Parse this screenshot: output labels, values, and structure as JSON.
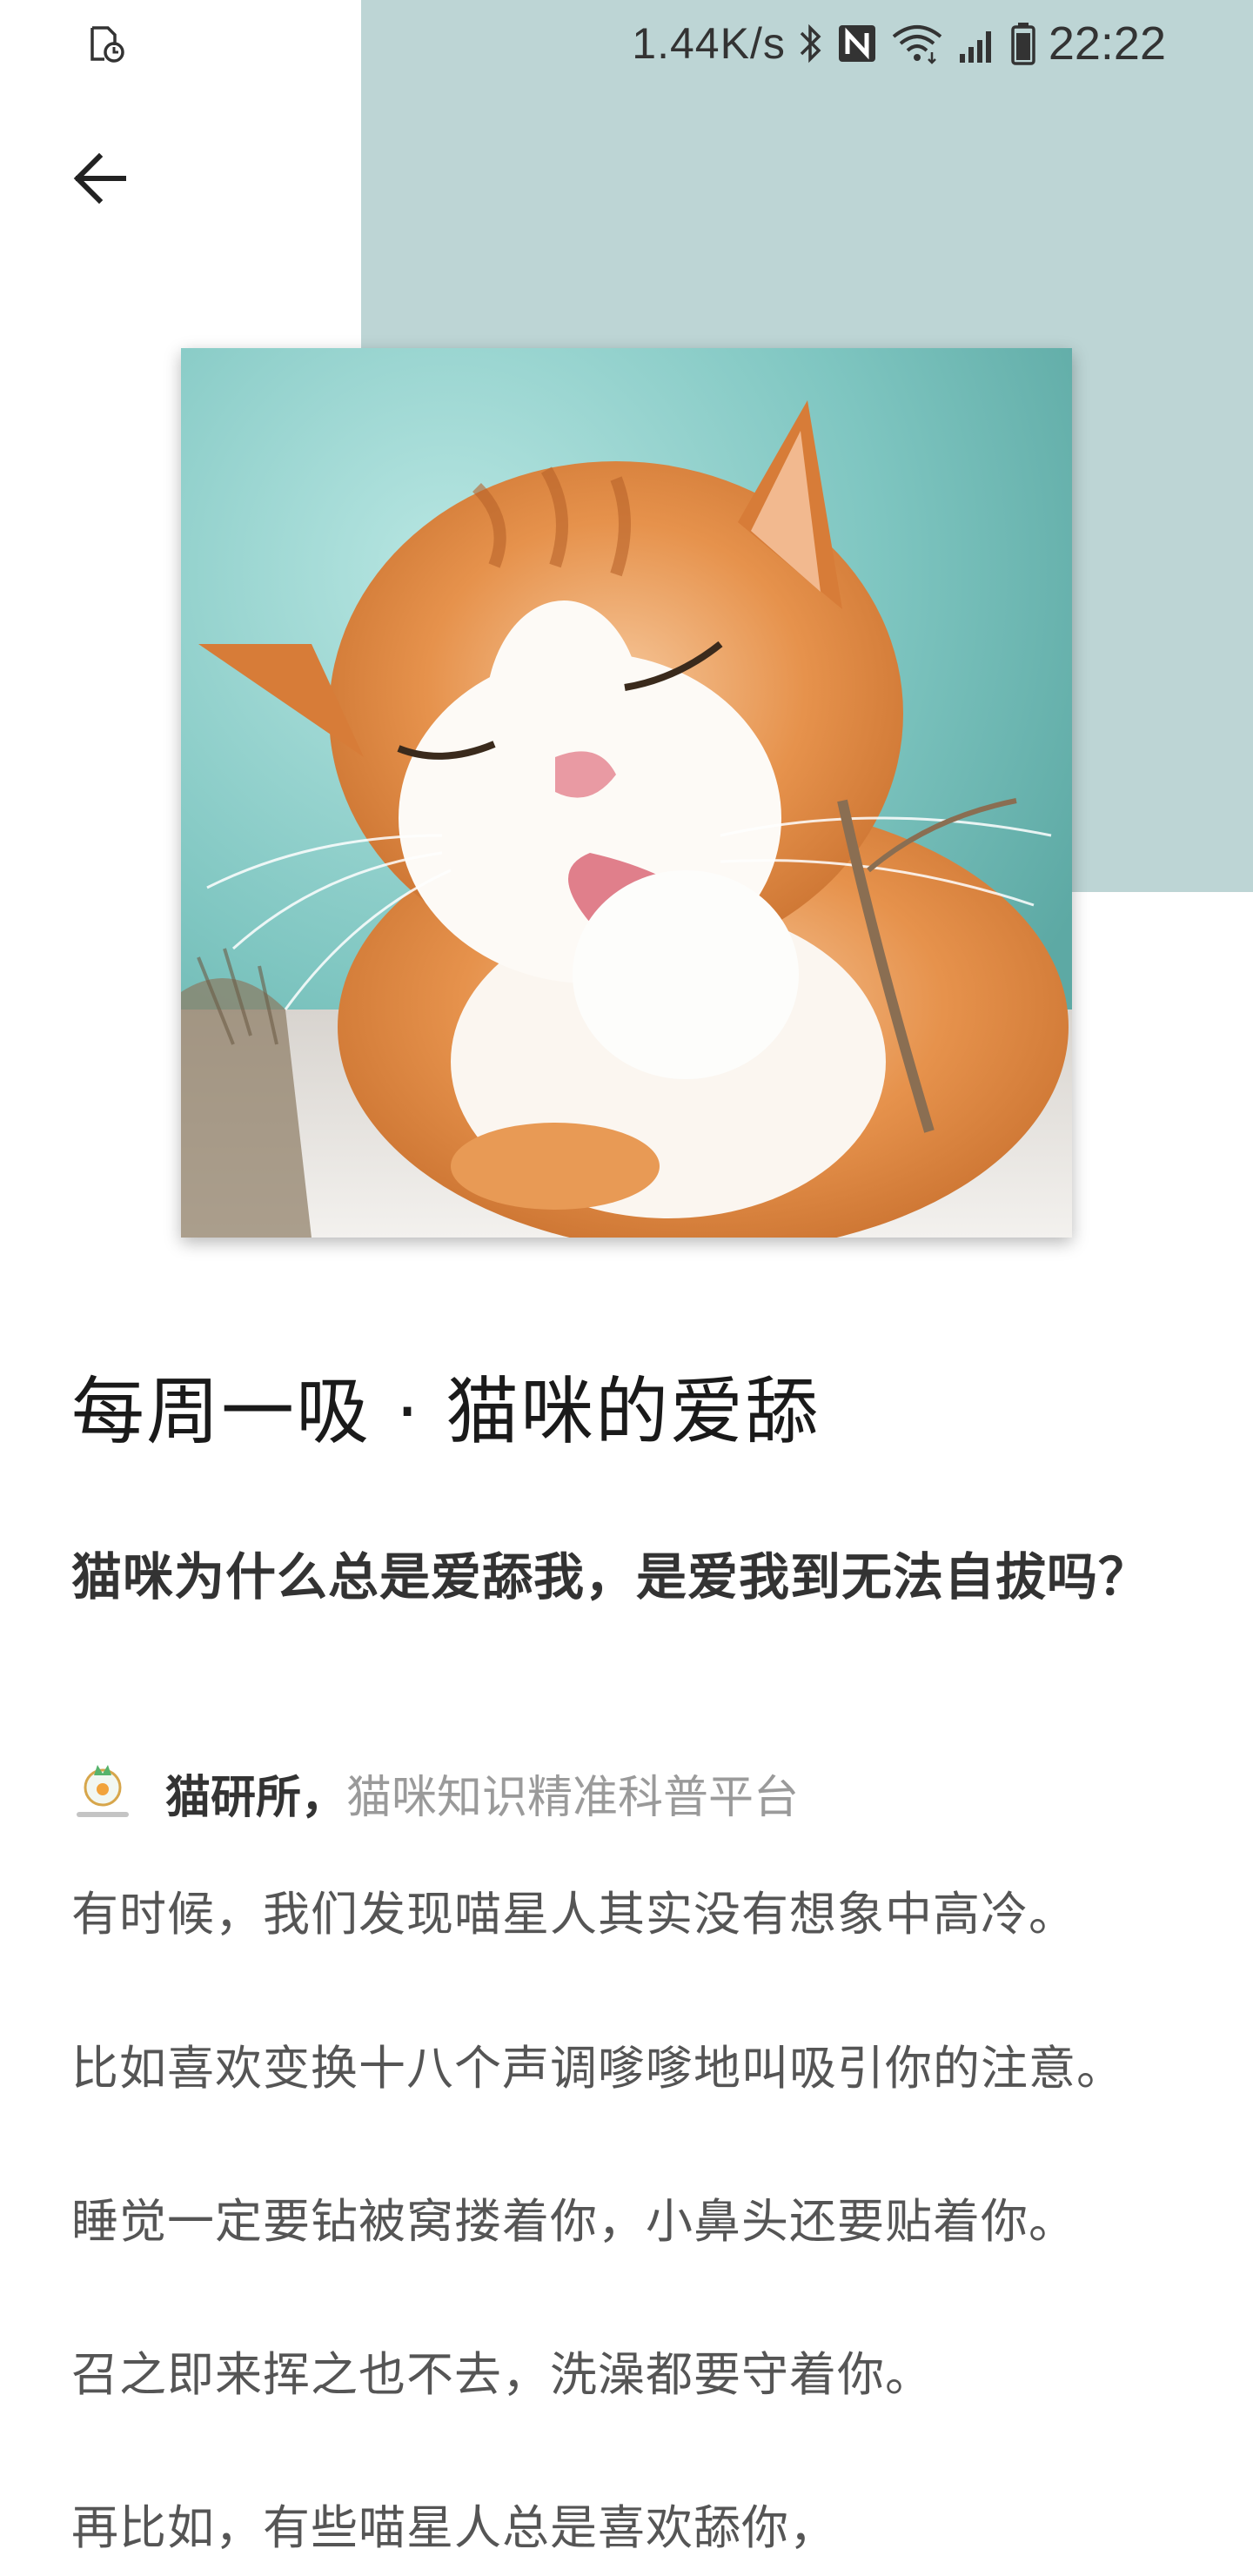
{
  "status_bar": {
    "net_speed": "1.44K/s",
    "time": "22:22",
    "icons": [
      "sim-card-clock-icon",
      "bluetooth-icon",
      "nfc-icon",
      "wifi-icon",
      "signal-icon",
      "battery-icon"
    ]
  },
  "header": {
    "back_icon": "arrow-left-icon"
  },
  "article": {
    "cover_image": "cat-licking-paw-photo",
    "title": "每周一吸 · 猫咪的爱舔",
    "subtitle": "猫咪为什么总是爱舔我，是爱我到无法自拔吗？",
    "author": {
      "name": "猫研所，",
      "description": "猫咪知识精准科普平台"
    },
    "paragraphs": [
      "有时候，我们发现喵星人其实没有想象中高冷。",
      "比如喜欢变换十八个声调嗲嗲地叫吸引你的注意。",
      "睡觉一定要钻被窝搂着你，小鼻头还要贴着你。",
      "召之即来挥之也不去，洗澡都要守着你。",
      "再比如，有些喵星人总是喜欢舔你，"
    ]
  },
  "colors": {
    "accent_teal": "#bdd5d5",
    "title_text": "#1a1a1a",
    "body_text": "#555555",
    "muted_text": "#9a9a9a"
  }
}
